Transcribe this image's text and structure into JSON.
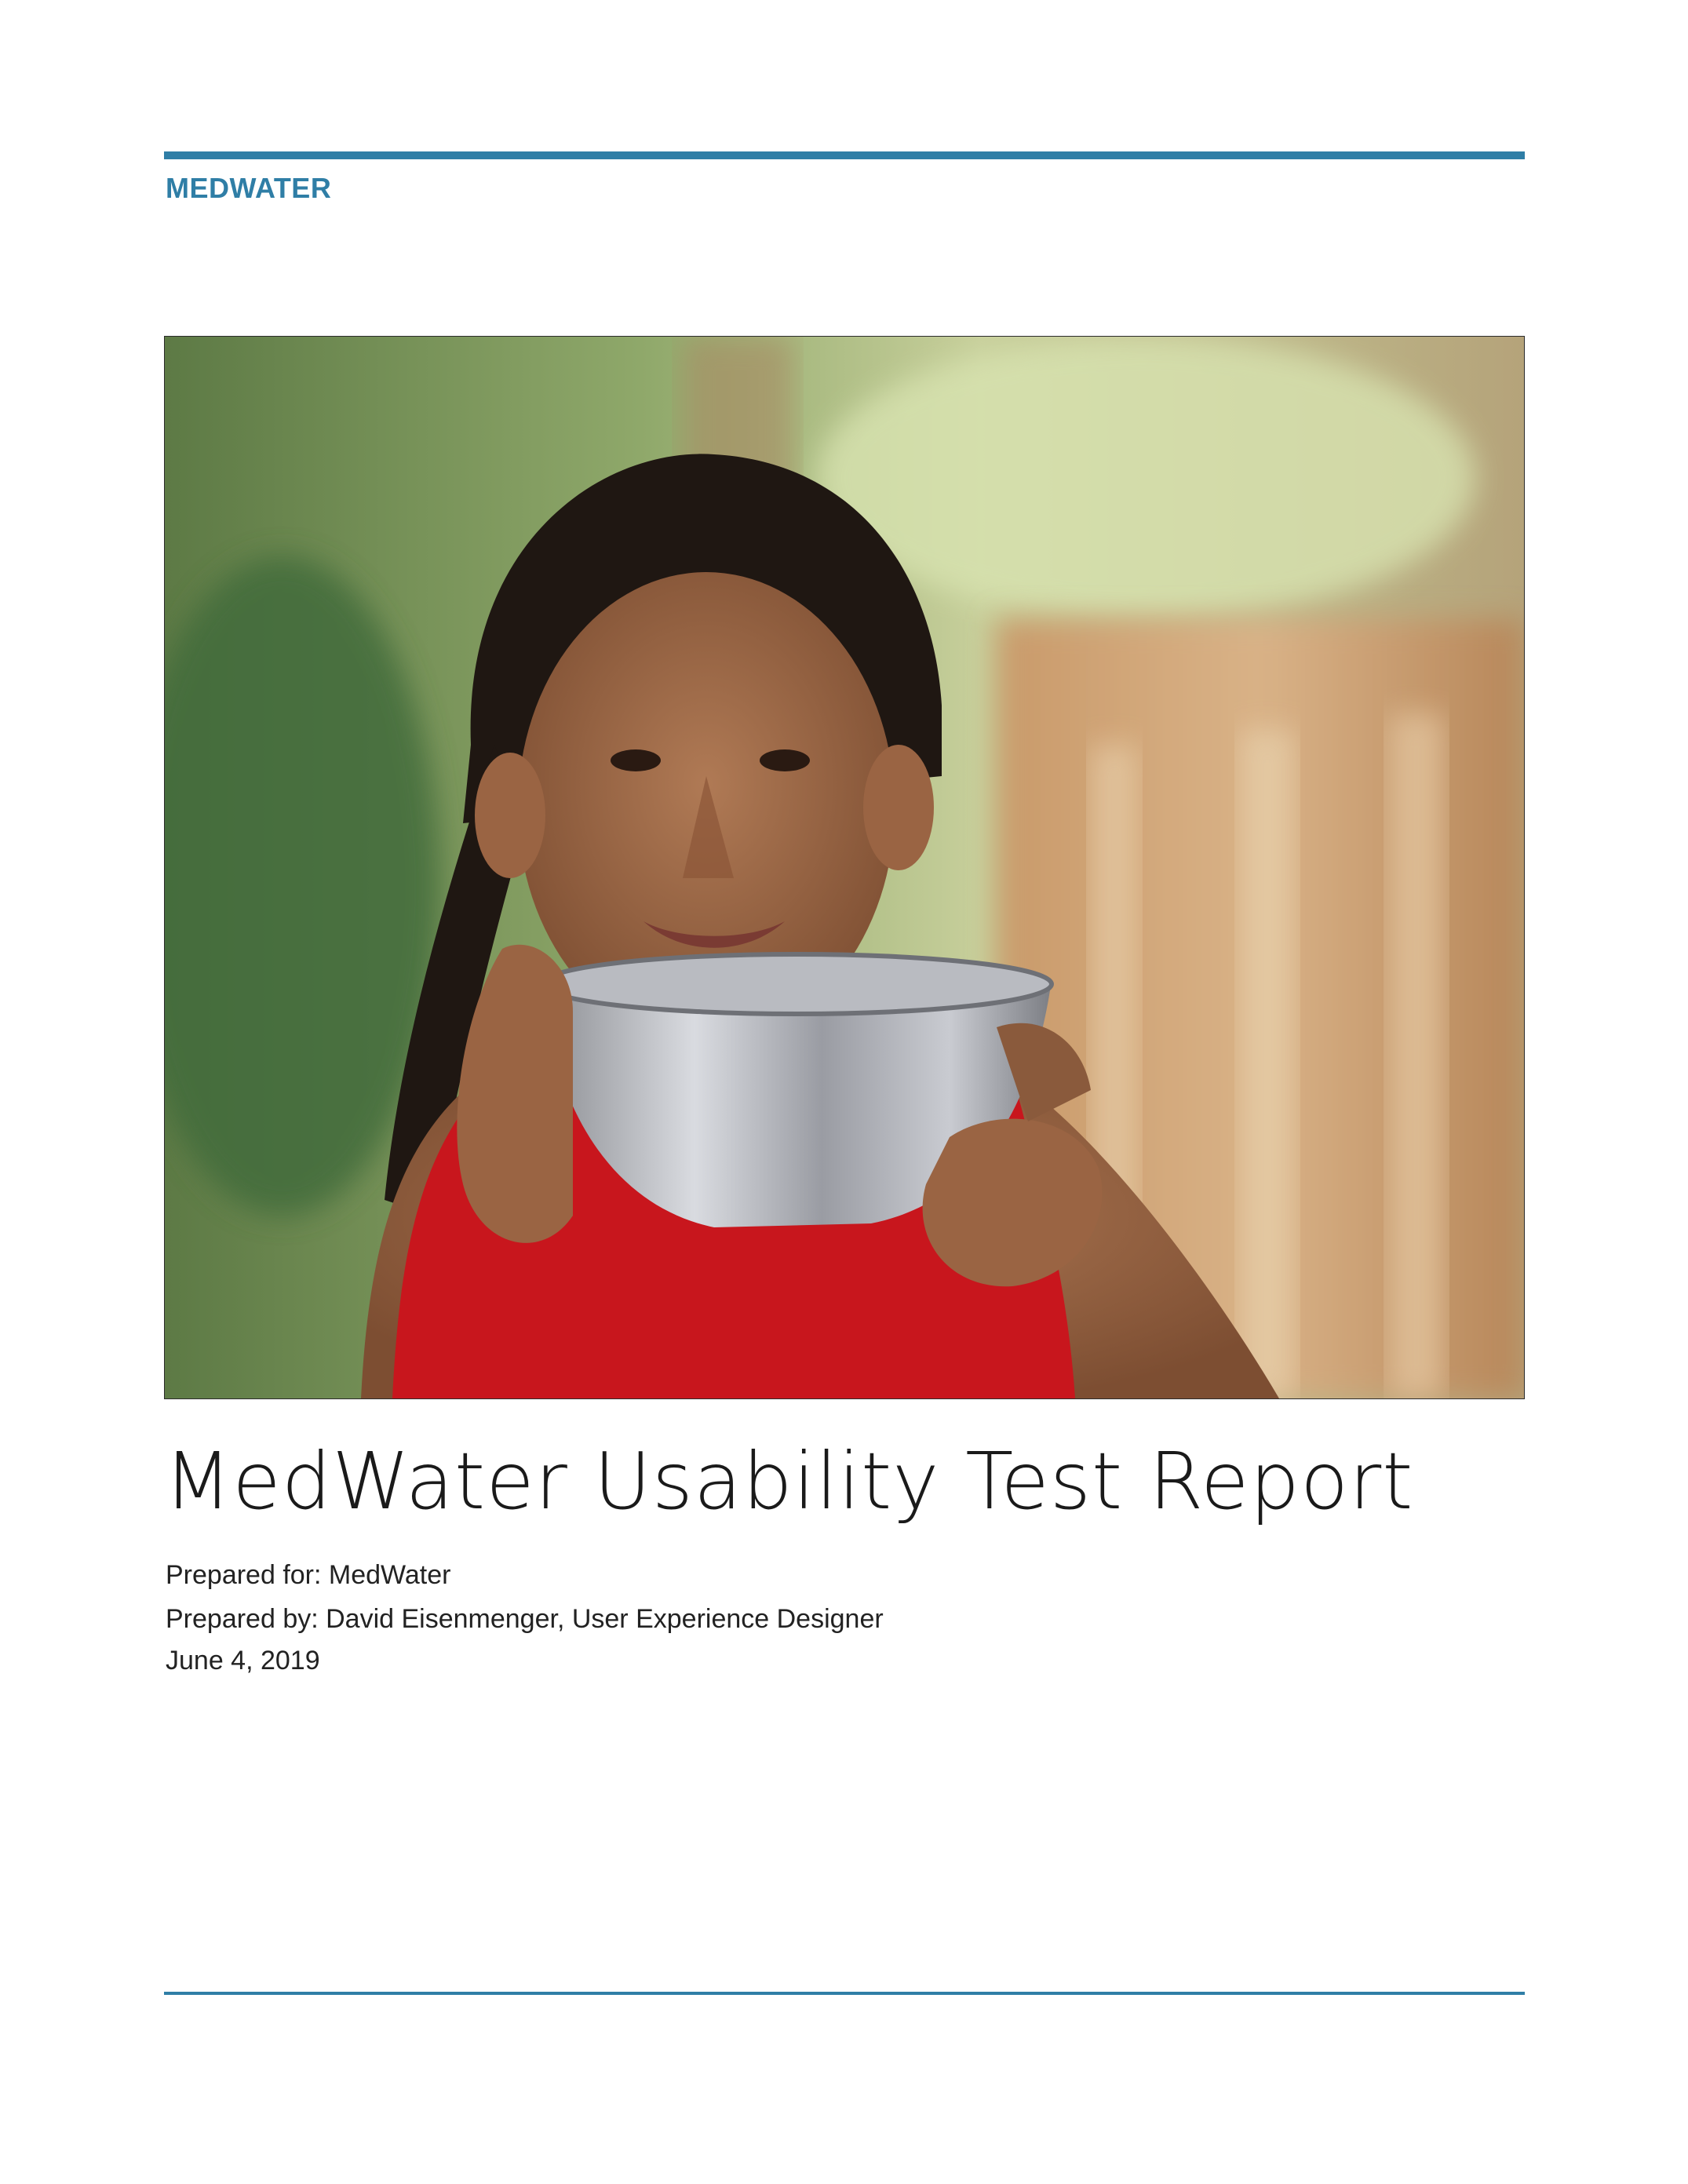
{
  "header": {
    "brand": "MEDWATER"
  },
  "cover_photo": {
    "subject": "woman holding a metal bowl"
  },
  "report": {
    "title": "MedWater Usability Test Report",
    "prepared_for": "Prepared for: MedWater",
    "prepared_by": "Prepared by: David Eisenmenger, User Experience Designer",
    "date": "June 4, 2019"
  },
  "colors": {
    "accent": "#2f7ea6",
    "text": "#1a1a1a"
  }
}
